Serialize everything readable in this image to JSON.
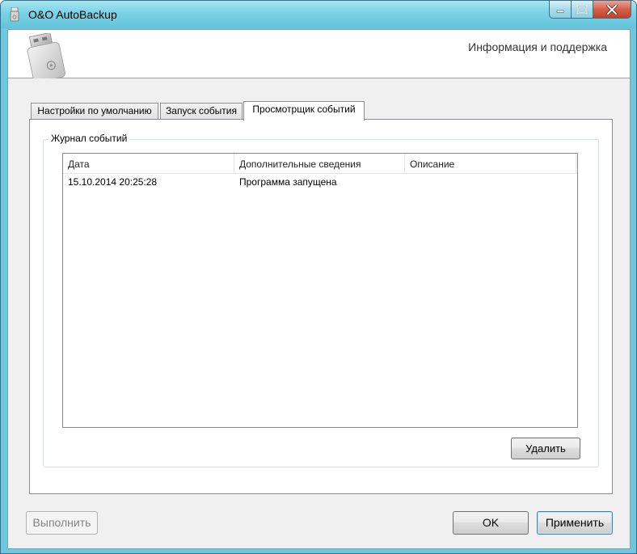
{
  "window": {
    "title": "O&O AutoBackup",
    "app_icon": "usb-stick-icon",
    "controls": {
      "minimize": "minimize-icon",
      "maximize": "maximize-icon",
      "close": "close-icon"
    }
  },
  "header": {
    "title": "Информация и поддержка",
    "illustration": "usb-drive-icon"
  },
  "tabs": [
    {
      "label": "Настройки по умолчанию",
      "active": false
    },
    {
      "label": "Запуск события",
      "active": false
    },
    {
      "label": "Просмотрщик событий",
      "active": true
    }
  ],
  "event_log": {
    "group_title": "Журнал событий",
    "columns": [
      "Дата",
      "Дополнительные сведения",
      "Описание"
    ],
    "rows": [
      [
        "15.10.2014 20:25:28",
        "Программа запущена",
        ""
      ]
    ],
    "delete_label": "Удалить"
  },
  "footer": {
    "execute_label": "Выполнить",
    "ok_label": "OK",
    "apply_label": "Применить"
  },
  "colors": {
    "titlebar": "#79d2e4",
    "close_button": "#d4604a",
    "dialog_bg": "#f0f0f0"
  }
}
